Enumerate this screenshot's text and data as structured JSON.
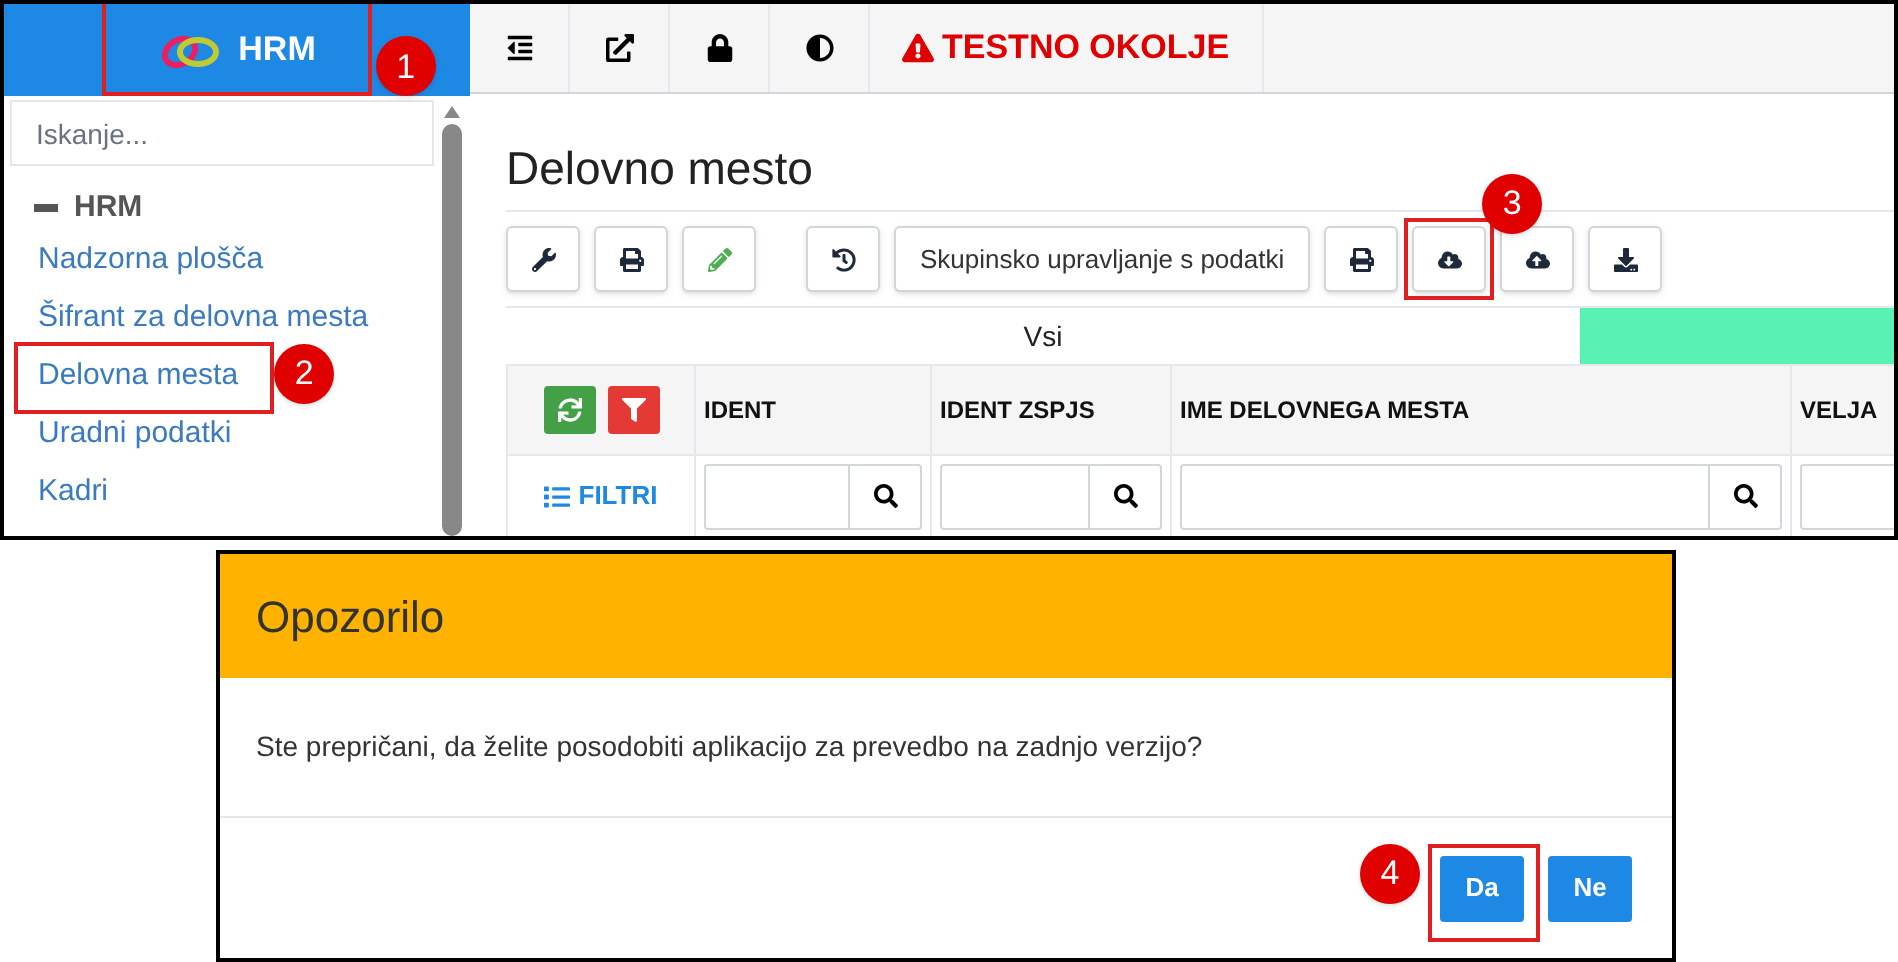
{
  "app": {
    "logo_text": "HRM",
    "callout": "1"
  },
  "topbar": [
    {
      "kind": "outdent"
    },
    {
      "kind": "external"
    },
    {
      "kind": "lock"
    },
    {
      "kind": "contrast"
    },
    {
      "kind": "warning",
      "label": "TESTNO OKOLJE"
    }
  ],
  "sidebar": {
    "search_placeholder": "Iskanje...",
    "section": {
      "label": "HRM",
      "expanded": true
    },
    "items": [
      {
        "label": "Nadzorna plošča"
      },
      {
        "label": "Šifrant za delovna mesta"
      },
      {
        "label": "Delovna mesta",
        "callout": "2"
      },
      {
        "label": "Uradni podatki"
      },
      {
        "label": "Kadri"
      }
    ]
  },
  "page": {
    "title": "Delovno mesto",
    "toolbar": [
      {
        "kind": "wrench"
      },
      {
        "kind": "print"
      },
      {
        "kind": "edit"
      },
      {
        "kind": "history"
      },
      {
        "kind": "text",
        "label": "Skupinsko upravljanje s podatki"
      },
      {
        "kind": "print"
      },
      {
        "kind": "clouddown",
        "callout": "3"
      },
      {
        "kind": "cloudup"
      },
      {
        "kind": "download"
      }
    ],
    "tab": {
      "label": "Vsi"
    },
    "table": {
      "filters_label": "FILTRI",
      "columns": [
        "IDENT",
        "IDENT ZSPJS",
        "IME DELOVNEGA MESTA",
        "VELJA"
      ]
    }
  },
  "dialog": {
    "title": "Opozorilo",
    "message": "Ste prepričani, da želite posodobiti aplikacijo za prevedbo na zadnjo verzijo?",
    "buttons": [
      {
        "label": "Da",
        "callout": "4"
      },
      {
        "label": "Ne"
      }
    ]
  }
}
